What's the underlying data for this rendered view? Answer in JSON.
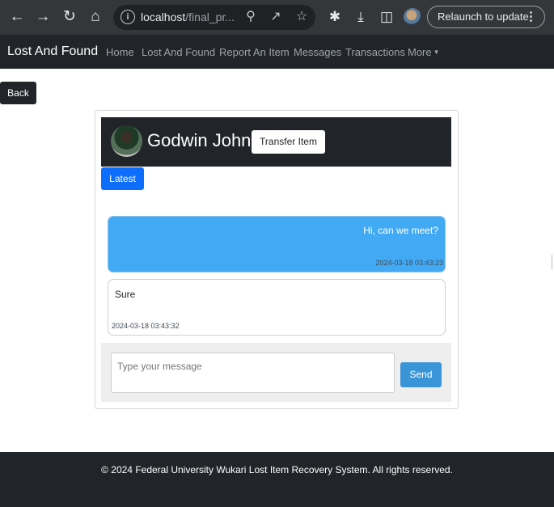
{
  "browser": {
    "url_host": "localhost",
    "url_path": "/final_pr...",
    "relaunch_label": "Relaunch to update",
    "icons": [
      "back-arrow-icon",
      "forward-arrow-icon",
      "reload-icon",
      "home-icon",
      "info-icon",
      "zoom-icon",
      "share-icon",
      "star-icon",
      "puzzle-icon",
      "download-icon",
      "sidepanel-icon",
      "profile-avatar",
      "more-vert-icon"
    ]
  },
  "navbar": {
    "brand": "Lost And Found",
    "links": [
      "Home",
      "Lost And Found",
      "Report An Item",
      "Messages",
      "Transactions",
      "More"
    ]
  },
  "page": {
    "back_label": "Back"
  },
  "chat": {
    "name": "Godwin John",
    "transfer_label": "Transfer Item",
    "latest_label": "Latest",
    "messages": [
      {
        "text": "Hi, can we meet?",
        "time": "2024-03-18 03:43:23",
        "direction": "sent"
      },
      {
        "text": "Sure",
        "time": "2024-03-18 03:43:32",
        "direction": "received"
      }
    ],
    "input_placeholder": "Type your message",
    "send_label": "Send"
  },
  "footer": {
    "text": "© 2024 Federal University Wukari Lost Item Recovery System. All rights reserved."
  },
  "colors": {
    "chrome_bg": "#35363a",
    "navbar_bg": "#212529",
    "primary": "#0d6efd",
    "sent_bubble": "#42aaf5",
    "send_button": "#3a95d8"
  }
}
